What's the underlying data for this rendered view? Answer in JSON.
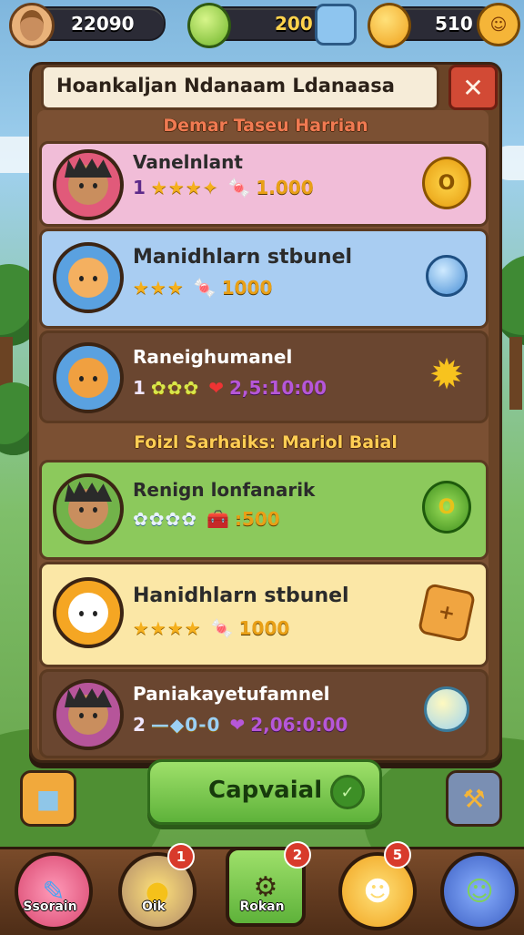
{
  "top_bar": {
    "currency_1": {
      "value": "22090",
      "icon": "player-avatar-icon"
    },
    "currency_2": {
      "value": "200",
      "icon": "gem-icon"
    },
    "currency_3": {
      "value": "510",
      "icon": "coin-icon"
    }
  },
  "panel": {
    "title": "Hoankaljan Ndanaam Ldanaasa",
    "close_label": "✕",
    "section_1": "Demar Taseu Harrian",
    "section_2": "Foizl Sarhaiks: Mariol Baial",
    "cards": [
      {
        "name": "Vanelnlant",
        "rank": "1",
        "stars": "★★★",
        "star_extra": "✦",
        "reward": "1.000",
        "reward_icon": "candy-icon",
        "badge_icon": "gold-coin-icon",
        "color": "#f1bdd8"
      },
      {
        "name": "Manidhlarn stbunel",
        "rank": "",
        "stars": "★★★",
        "star_extra": "",
        "reward": "1000",
        "reward_icon": "candy-icon",
        "badge_icon": "ice-cream-icon",
        "color": "#a9cdf2"
      },
      {
        "name": "Raneighumanel",
        "rank": "1",
        "stars": "✿✿✿",
        "star_extra": "",
        "reward": "2,5:10:00",
        "reward_icon": "heart-icon",
        "badge_icon": "sun-medal-icon",
        "color": "#6a4630"
      },
      {
        "name": "Renign lonfanarik",
        "rank": "",
        "stars": "✿✿✿✿",
        "star_extra": "",
        "reward": ":500",
        "reward_icon": "treasure-icon",
        "badge_icon": "green-coin-icon",
        "color": "#8cc95c"
      },
      {
        "name": "Hanidhlarn stbunel",
        "rank": "",
        "stars": "★★★★",
        "star_extra": "",
        "reward": "1000",
        "reward_icon": "candy-icon",
        "badge_icon": "cracker-icon",
        "color": "#fbe7a6"
      },
      {
        "name": "Paniakayetufamnel",
        "rank": "2",
        "stars": "—◆0-0",
        "star_extra": "",
        "reward": "2,06:0:00",
        "reward_icon": "heart-icon",
        "badge_icon": "lollipop-icon",
        "color": "#6a4630"
      }
    ]
  },
  "claim_button": {
    "label": "Capvaial",
    "icon": "check-icon"
  },
  "side_buttons": {
    "left_icon": "box-icon",
    "right_icon": "hammer-icon"
  },
  "bottom_nav": [
    {
      "label": "Ssorain",
      "icon": "brush-icon",
      "badge": ""
    },
    {
      "label": "Oik",
      "icon": "chick-icon",
      "badge": "1"
    },
    {
      "label": "Rokan",
      "icon": "gear-icon",
      "badge": "2"
    },
    {
      "label": "",
      "icon": "cat-icon",
      "badge": "5"
    },
    {
      "label": "",
      "icon": "character-icon",
      "badge": ""
    }
  ]
}
